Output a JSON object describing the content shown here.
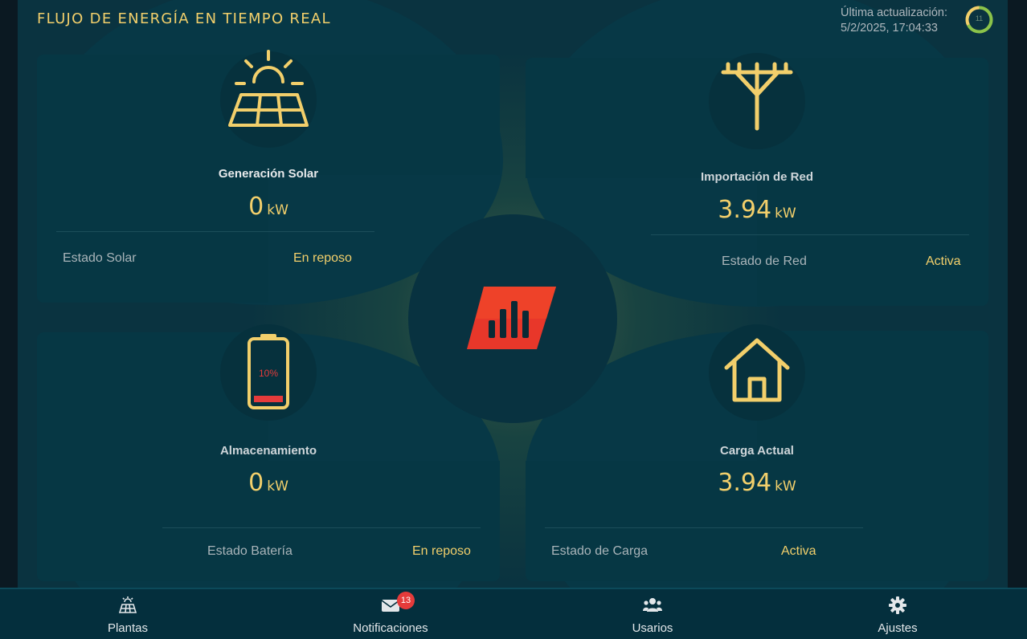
{
  "header": {
    "title": "FLUJO DE ENERGÍA EN TIEMPO REAL",
    "updated_label": "Última actualización:",
    "updated_value": "5/2/2025, 17:04:33",
    "refresh_countdown": "11"
  },
  "solar": {
    "label": "Generación Solar",
    "value": "0",
    "unit": "kW",
    "status_label": "Estado Solar",
    "status_value": "En reposo"
  },
  "grid": {
    "label": "Importación de Red",
    "value": "3.94",
    "unit": "kW",
    "status_label": "Estado de Red",
    "status_value": "Activa"
  },
  "battery": {
    "label": "Almacenamiento",
    "value": "0",
    "unit": "kW",
    "charge_percent": "10%",
    "charge_fraction": 0.1,
    "status_label": "Estado Batería",
    "status_value": "En reposo"
  },
  "load": {
    "label": "Carga Actual",
    "value": "3.94",
    "unit": "kW",
    "status_label": "Estado de Carga",
    "status_value": "Activa"
  },
  "nav": {
    "plants": "Plantas",
    "notifications": "Notificaciones",
    "notifications_badge": "13",
    "users": "Usarios",
    "settings": "Ajustes"
  },
  "colors": {
    "accent": "#f2cf6b",
    "panel": "#063744",
    "badge": "#e53b3b",
    "logo_red": "#e8372a"
  },
  "icons": {
    "solar": "solar-panel-icon",
    "grid": "power-pole-icon",
    "battery": "battery-icon",
    "load": "house-icon",
    "center": "logo-icon",
    "nav": [
      "solar-panel-icon",
      "envelope-icon",
      "users-icon",
      "gear-icon"
    ]
  }
}
